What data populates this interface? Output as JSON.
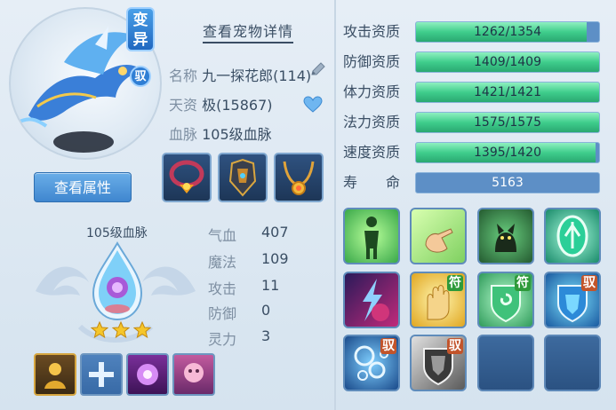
{
  "pet": {
    "mutation_badge": "变异",
    "tamed_badge": "驭",
    "view_attributes_label": "查看属性",
    "details_title": "查看宠物详情",
    "name_label": "名称",
    "name_value": "九一探花郎(114)",
    "talent_label": "天资",
    "talent_value": "极(15867)",
    "bloodline_label": "血脉",
    "bloodline_value": "105级血脉"
  },
  "bloodline": {
    "title": "105级血脉",
    "stars": 3
  },
  "stats": [
    {
      "label": "气血",
      "value": "407"
    },
    {
      "label": "魔法",
      "value": "109"
    },
    {
      "label": "攻击",
      "value": "11"
    },
    {
      "label": "防御",
      "value": "0"
    },
    {
      "label": "灵力",
      "value": "3"
    }
  ],
  "qualities": [
    {
      "label": "攻击资质",
      "text": "1262/1354",
      "fraction": 0.932
    },
    {
      "label": "防御资质",
      "text": "1409/1409",
      "fraction": 1.0
    },
    {
      "label": "体力资质",
      "text": "1421/1421",
      "fraction": 1.0
    },
    {
      "label": "法力资质",
      "text": "1575/1575",
      "fraction": 1.0
    },
    {
      "label": "速度资质",
      "text": "1395/1420",
      "fraction": 0.982
    },
    {
      "label": "寿　　命",
      "text": "5163",
      "fraction": 0
    }
  ],
  "skill_tags": {
    "fu": "符",
    "yu": "驭"
  },
  "colors": {
    "bar_fill": "#3fcd8c",
    "bar_empty": "#5d8fc6",
    "title_text": "#3a4e64"
  }
}
